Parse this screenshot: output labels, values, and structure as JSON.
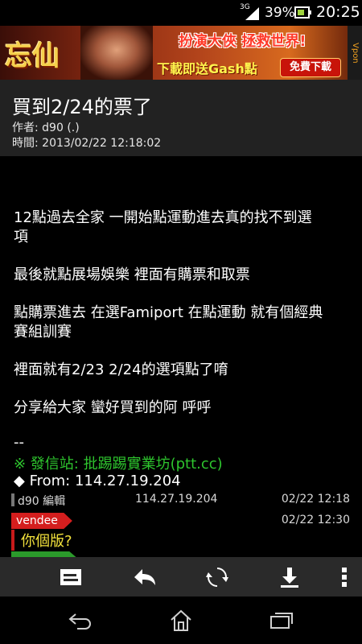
{
  "status": {
    "network": "3G",
    "battery_percent": "39%",
    "time": "20:25",
    "battery_level": 0.39,
    "icons": [
      "signal-icon",
      "battery-icon"
    ]
  },
  "ad": {
    "logo": "忘仙",
    "slogan": "扮演大俠 拯救世界!",
    "promo": "下載即送Gash點",
    "download_label": "免費下載",
    "brand": "Vpon"
  },
  "post": {
    "title": "買到2/24的票了",
    "author": "作者: d90 (.)",
    "time": "時間: 2013/02/22 12:18:02"
  },
  "body": {
    "lines": [
      "12點過去全家 一開始點運動進去真的找不到選",
      "項",
      "最後就點展場娛樂 裡面有購票和取票",
      "點購票進去 在選Famiport 在點運動 就有個經典",
      "賽組訓賽",
      "裡面就有2/23 2/24的選項點了唷",
      "分享給大家 蠻好買到的阿 呼呼",
      "--"
    ],
    "signature": "※ 發信站: 批踢踢實業坊(ptt.cc)",
    "from": "◆ From: 114.27.19.204"
  },
  "edit": {
    "label": "d90 編輯",
    "ip": "114.27.19.204",
    "time": "02/22 12:18"
  },
  "pushes": [
    {
      "user": "vendee",
      "time": "02/22 12:30",
      "text": "你個版?",
      "tag_color": "#d41e1e"
    },
    {
      "user": "",
      "time": "",
      "text": "",
      "tag_color": "#2b9a2b"
    }
  ],
  "toolbar": {
    "items": [
      "reply-post-icon",
      "back-reply-icon",
      "refresh-icon",
      "download-icon",
      "overflow-menu-icon"
    ]
  },
  "navbar": {
    "items": [
      "nav-back-icon",
      "nav-home-icon",
      "nav-recent-apps-icon"
    ]
  }
}
